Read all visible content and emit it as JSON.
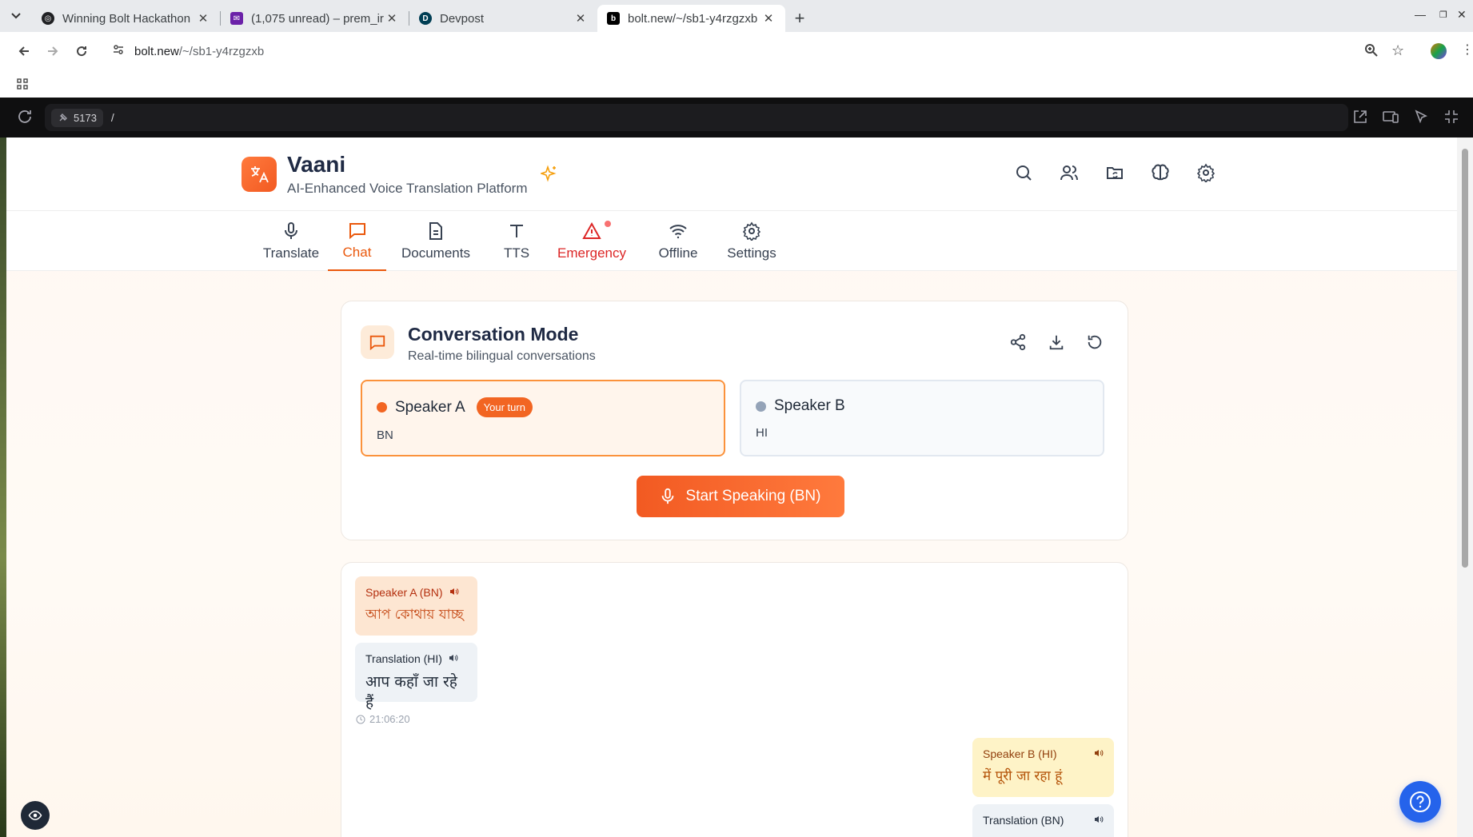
{
  "browser": {
    "tabs": [
      {
        "title": "Winning Bolt Hackathon",
        "favicon_color": "#202124"
      },
      {
        "title": "(1,075 unread) – prem_ir",
        "favicon_color": "#6b21a8"
      },
      {
        "title": "Devpost",
        "favicon_color": "#003e54"
      },
      {
        "title": "bolt.new/~/sb1-y4rzgzxb",
        "favicon_color": "#000000"
      }
    ],
    "active_tab_index": 3,
    "url_host": "bolt.new",
    "url_path": "/~/sb1-y4rzgzxb"
  },
  "preview": {
    "port": "5173",
    "path": "/"
  },
  "app": {
    "brand": {
      "title": "Vaani",
      "subtitle": "AI-Enhanced Voice Translation Platform"
    },
    "header_icons": [
      "search-icon",
      "users-icon",
      "folder-sync-icon",
      "brain-icon",
      "settings-gear-icon"
    ],
    "nav_tabs": [
      {
        "label": "Translate",
        "icon": "mic-icon"
      },
      {
        "label": "Chat",
        "icon": "chat-icon",
        "active": true
      },
      {
        "label": "Documents",
        "icon": "document-icon"
      },
      {
        "label": "TTS",
        "icon": "text-icon"
      },
      {
        "label": "Emergency",
        "icon": "alert-triangle-icon",
        "alert": true
      },
      {
        "label": "Offline",
        "icon": "wifi-icon"
      },
      {
        "label": "Settings",
        "icon": "gear-icon"
      }
    ],
    "conversation": {
      "title": "Conversation Mode",
      "subtitle": "Real-time bilingual conversations",
      "speaker_a": {
        "name": "Speaker A",
        "badge": "Your turn",
        "lang": "BN",
        "dot_color": "#f26522"
      },
      "speaker_b": {
        "name": "Speaker B",
        "lang": "HI",
        "dot_color": "#94a3b8"
      },
      "speak_button": "Start Speaking (BN)"
    },
    "messages": [
      {
        "original_label": "Speaker A (BN)",
        "original_text": "আপ কোথায় যাচ্ছ",
        "translation_label": "Translation (HI)",
        "translation_text": "आप कहाँ जा रहे हैं",
        "time": "21:06:20"
      },
      {
        "original_label": "Speaker B (HI)",
        "original_text": "में पूरी जा रहा हूं",
        "translation_label": "Translation (BN)"
      }
    ],
    "colors": {
      "accent": "#f25a22",
      "active_tab": "#ea580c",
      "danger": "#dc2626",
      "help_button": "#2563eb"
    }
  }
}
